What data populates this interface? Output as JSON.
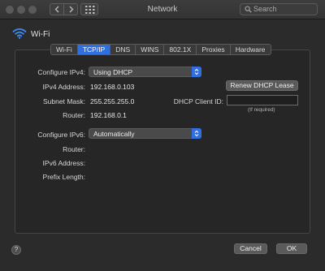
{
  "window": {
    "title": "Network"
  },
  "search": {
    "placeholder": "Search"
  },
  "interface": {
    "name": "Wi-Fi"
  },
  "tabs": [
    {
      "label": "Wi-Fi"
    },
    {
      "label": "TCP/IP"
    },
    {
      "label": "DNS"
    },
    {
      "label": "WINS"
    },
    {
      "label": "802.1X"
    },
    {
      "label": "Proxies"
    },
    {
      "label": "Hardware"
    }
  ],
  "active_tab": "TCP/IP",
  "ipv4": {
    "configure_label": "Configure IPv4:",
    "configure_value": "Using DHCP",
    "address_label": "IPv4 Address:",
    "address_value": "192.168.0.103",
    "subnet_label": "Subnet Mask:",
    "subnet_value": "255.255.255.0",
    "router_label": "Router:",
    "router_value": "192.168.0.1",
    "renew_button": "Renew DHCP Lease",
    "client_id_label": "DHCP Client ID:",
    "client_id_value": "",
    "client_id_hint": "(If required)"
  },
  "ipv6": {
    "configure_label": "Configure IPv6:",
    "configure_value": "Automatically",
    "router_label": "Router:",
    "address_label": "IPv6 Address:",
    "prefix_label": "Prefix Length:"
  },
  "footer": {
    "help": "?",
    "cancel_button": "Cancel",
    "ok_button": "OK"
  },
  "colors": {
    "accent": "#2f6fe0",
    "wifi_icon": "#3b8ef5"
  }
}
